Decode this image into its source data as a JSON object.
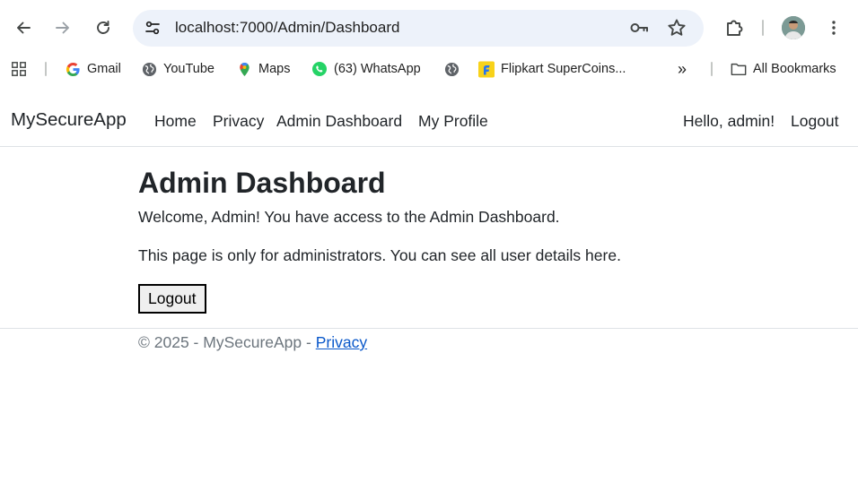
{
  "browser": {
    "url": "localhost:7000/Admin/Dashboard",
    "icons": {
      "back": "arrow-left-icon",
      "forward": "arrow-right-icon",
      "reload": "reload-icon",
      "site_settings": "tune-icon",
      "password": "key-icon",
      "bookmark": "star-icon",
      "extensions": "puzzle-icon",
      "menu": "kebab-menu-icon"
    },
    "colors": {
      "omnibox_bg": "#edf2fa"
    }
  },
  "bookmarks": {
    "items": [
      {
        "label": "Gmail",
        "icon": "google-icon"
      },
      {
        "label": "YouTube",
        "icon": "globe-icon"
      },
      {
        "label": "Maps",
        "icon": "maps-pin-icon"
      },
      {
        "label": "(63) WhatsApp",
        "icon": "whatsapp-icon"
      },
      {
        "label": "",
        "icon": "globe-icon"
      },
      {
        "label": "Flipkart SuperCoins...",
        "icon": "flipkart-icon"
      }
    ],
    "overflow_label": "»",
    "all_bookmarks_label": "All Bookmarks"
  },
  "navbar": {
    "brand": "MySecureApp",
    "links": [
      "Home",
      "Privacy",
      "Admin Dashboard",
      "My Profile"
    ],
    "greeting": "Hello, admin!",
    "logout_label": "Logout"
  },
  "main": {
    "title": "Admin Dashboard",
    "welcome": "Welcome, Admin! You have access to the Admin Dashboard.",
    "description": "This page is only for administrators. You can see all user details here.",
    "logout_button": "Logout"
  },
  "footer": {
    "text": "© 2025 - MySecureApp - ",
    "privacy_link": "Privacy"
  }
}
